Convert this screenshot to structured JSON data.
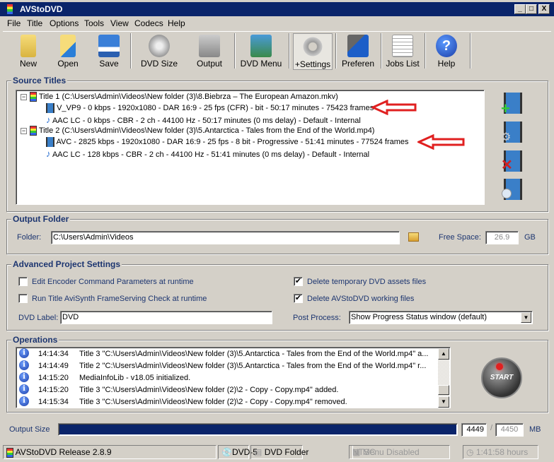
{
  "window": {
    "title": "AVStoDVD",
    "min": "_",
    "max": "□",
    "close": "X"
  },
  "menu": [
    "File",
    "Title",
    "Options",
    "Tools",
    "View",
    "Codecs",
    "Help"
  ],
  "toolbar": {
    "new": "New",
    "open": "Open",
    "save": "Save",
    "dvd_size": "DVD Size",
    "output": "Output",
    "dvd_menu": "DVD Menu",
    "settings": "+Settings",
    "preferences": "Preferen",
    "jobs_list": "Jobs List",
    "help": "Help"
  },
  "source_titles": {
    "label": "Source Titles",
    "items": [
      {
        "title": "Title 1 (C:\\Users\\Admin\\Videos\\New folder (3)\\8.Biebrza – The European Amazon.mkv)",
        "video": "V_VP9 - 0 kbps - 1920x1080 - DAR 16:9 - 25 fps (CFR) -  bit - 50:17 minutes - 75423 frames",
        "audio": "AAC LC - 0 kbps - CBR - 2 ch - 44100 Hz - 50:17 minutes (0 ms delay) - Default - Internal"
      },
      {
        "title": "Title 2 (C:\\Users\\Admin\\Videos\\New folder (3)\\5.Antarctica - Tales from the End of the World.mp4)",
        "video": "AVC - 2825 kbps - 1920x1080 - DAR 16:9 - 25 fps - 8 bit - Progressive - 51:41 minutes - 77524 frames",
        "audio": "AAC LC - 128 kbps - CBR - 2 ch - 44100 Hz - 51:41 minutes (0 ms delay) - Default - Internal"
      }
    ]
  },
  "output_folder": {
    "label": "Output Folder",
    "folder_label": "Folder:",
    "folder_value": "C:\\Users\\Admin\\Videos",
    "free_space_label": "Free Space:",
    "free_space_value": "26.9",
    "free_space_unit": "GB"
  },
  "advanced": {
    "label": "Advanced Project Settings",
    "edit_encoder": "Edit Encoder Command Parameters at runtime",
    "run_check": "Run Title AviSynth FrameServing Check at runtime",
    "delete_temp": "Delete temporary DVD assets files",
    "delete_working": "Delete AVStoDVD working files",
    "dvd_label_label": "DVD Label:",
    "dvd_label_value": "DVD",
    "post_process_label": "Post Process:",
    "post_process_value": "Show Progress Status window (default)",
    "checks": {
      "edit_encoder": false,
      "run_check": false,
      "delete_temp": true,
      "delete_working": true
    }
  },
  "operations": {
    "label": "Operations",
    "start": "START",
    "log": [
      {
        "time": "14:14:34",
        "msg": "Title 3 \"C:\\Users\\Admin\\Videos\\New folder (3)\\5.Antarctica - Tales from the End of the World.mp4\" a..."
      },
      {
        "time": "14:14:49",
        "msg": "Title 2 \"C:\\Users\\Admin\\Videos\\New folder (3)\\5.Antarctica - Tales from the End of the World.mp4\" r..."
      },
      {
        "time": "14:15:20",
        "msg": "MediaInfoLib - v18.05 initialized."
      },
      {
        "time": "14:15:20",
        "msg": "Title 3 \"C:\\Users\\Admin\\Videos\\New folder (2)\\2 - Copy - Copy.mp4\" added."
      },
      {
        "time": "14:15:34",
        "msg": "Title 3 \"C:\\Users\\Admin\\Videos\\New folder (2)\\2 - Copy - Copy.mp4\" removed."
      }
    ]
  },
  "output_size": {
    "label": "Output Size",
    "value": "4449",
    "max": "4450",
    "sep": "/",
    "unit": "MB",
    "fill_percent": 99.98
  },
  "status": {
    "release": "AVStoDVD Release 2.8.9",
    "dvd": "DVD-5",
    "folder": "DVD Folder",
    "ntsc": "NTSC",
    "menu": "Menu Disabled",
    "duration": "1:41:58 hours"
  },
  "colors": {
    "titlebar": "#0a246a",
    "progress": "#0a246a",
    "arrow": "#e02020"
  }
}
